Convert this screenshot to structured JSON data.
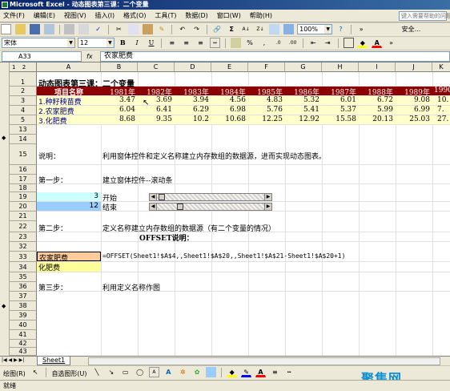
{
  "window": {
    "title": "Microsoft Excel - 动态图表第三课：二个变量"
  },
  "menu": [
    "文件(F)",
    "编辑(E)",
    "视图(V)",
    "插入(I)",
    "格式(O)",
    "工具(T)",
    "数据(D)",
    "窗口(W)",
    "帮助(H)"
  ],
  "help_placeholder": "键入需要帮助的问题",
  "toolbar": {
    "zoom": "100%",
    "security": "安全...",
    "font_name": "宋体",
    "font_size": "12",
    "bold": "B",
    "italic": "I",
    "underline": "U"
  },
  "formula_bar": {
    "name_box": "A33",
    "fx": "fx",
    "formula": "农家肥费"
  },
  "columns": [
    "A",
    "B",
    "C",
    "D",
    "E",
    "F",
    "G",
    "H",
    "I",
    "J",
    "K"
  ],
  "outline_levels": [
    "1",
    "2"
  ],
  "rows": [
    {
      "num": "1",
      "a": "动态图表第三课：二个变量"
    },
    {
      "num": "2",
      "a": "项目名称",
      "values": [
        "1981年",
        "1982年",
        "1983年",
        "1984年",
        "1985年",
        "1986年",
        "1987年",
        "1988年",
        "1989年",
        "1990"
      ]
    },
    {
      "num": "3",
      "a": "1.种籽秧苗费",
      "values": [
        "3.47",
        "3.69",
        "3.94",
        "4.56",
        "4.83",
        "5.32",
        "6.01",
        "6.72",
        "9.08",
        "10."
      ]
    },
    {
      "num": "4",
      "a": "2.农家肥费",
      "values": [
        "6.04",
        "6.41",
        "6.29",
        "6.98",
        "5.76",
        "5.41",
        "5.37",
        "5.99",
        "6.99",
        "7."
      ]
    },
    {
      "num": "5",
      "a": "3.化肥费",
      "values": [
        "8.68",
        "9.35",
        "10.2",
        "10.68",
        "12.25",
        "12.92",
        "15.58",
        "20.13",
        "25.03",
        "27."
      ]
    },
    {
      "num": "13",
      "a": ""
    },
    {
      "num": "14",
      "a": ""
    },
    {
      "num": "15",
      "a": "说明：",
      "b": "利用窗体控件和定义名称建立内存数组的数据源，进而实现动态图表。"
    },
    {
      "num": "16",
      "a": ""
    },
    {
      "num": "17",
      "a": "第一步：",
      "b": "建立窗体控件--滚动条"
    },
    {
      "num": "18",
      "a": ""
    },
    {
      "num": "19",
      "a": "3",
      "b": "开始"
    },
    {
      "num": "20",
      "a": "12",
      "b": "结束"
    },
    {
      "num": "21",
      "a": ""
    },
    {
      "num": "22",
      "a": "第二步：",
      "b": "定义名称建立内存数组的数据源（有二个变量的情况）"
    },
    {
      "num": "23",
      "a": "",
      "c": "OFFSET说明："
    },
    {
      "num": "32",
      "a": ""
    },
    {
      "num": "33",
      "a": "农家肥费",
      "b": "=OFFSET(Sheet1!$A$4,,Sheet1!$A$20,,Sheet1!$A$21-Sheet1!$A$20+1)"
    },
    {
      "num": "34",
      "a": "化肥费"
    },
    {
      "num": "35",
      "a": ""
    },
    {
      "num": "36",
      "a": "第三步：",
      "b": "利用定义名称作图"
    },
    {
      "num": "37",
      "a": ""
    },
    {
      "num": "38",
      "a": ""
    },
    {
      "num": "39",
      "a": ""
    },
    {
      "num": "40",
      "a": ""
    },
    {
      "num": "41",
      "a": ""
    },
    {
      "num": "42",
      "a": ""
    },
    {
      "num": "43",
      "a": ""
    }
  ],
  "sheet_tab": "Sheet1",
  "draw_toolbar": {
    "draw": "绘图(R)",
    "autoshapes": "自选图形(U)"
  },
  "status": "就绪",
  "watermark": "聚集网",
  "colors": {
    "header_bg": "#8b0000",
    "data_bg": "#ffffcc",
    "cyan_bg": "#ccffff",
    "blue_bg": "#99ccff",
    "orange_bg": "#ffcc99"
  }
}
